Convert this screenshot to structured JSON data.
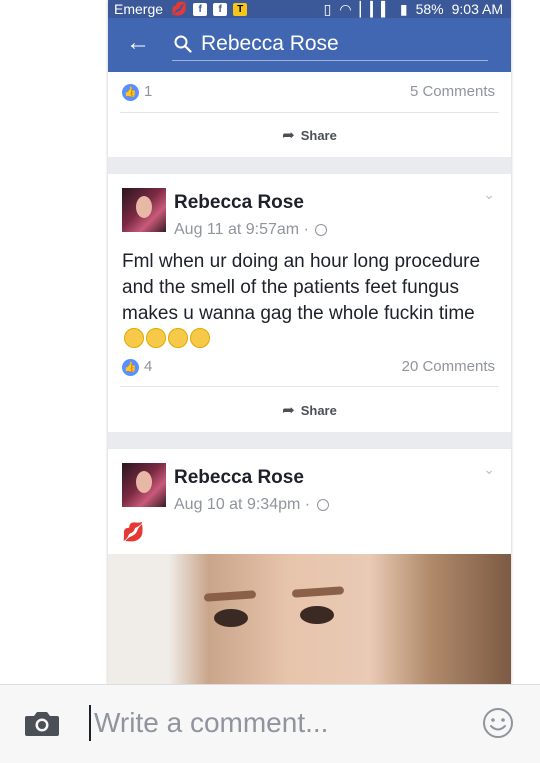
{
  "status_bar": {
    "carrier": "Emerge",
    "battery": "58%",
    "time": "9:03 AM"
  },
  "search": {
    "query": "Rebecca Rose"
  },
  "posts": [
    {
      "likes": "1",
      "comments": "5 Comments",
      "share_label": "Share"
    },
    {
      "author": "Rebecca Rose",
      "timestamp": "Aug 11 at 9:57am",
      "separator": "·",
      "text": "Fml when ur doing an hour long procedure and the smell of the patients feet fungus makes u wanna gag the whole fuckin time",
      "likes": "4",
      "comments": "20 Comments",
      "share_label": "Share"
    },
    {
      "author": "Rebecca Rose",
      "timestamp": "Aug 10 at 9:34pm",
      "separator": "·"
    }
  ],
  "composer": {
    "placeholder": "Write a comment..."
  },
  "colors": {
    "brand": "#3b5998",
    "navbar": "#4267b2",
    "like": "#5890ff"
  },
  "icons": [
    "back-arrow-icon",
    "search-icon",
    "share-arrow-icon",
    "globe-icon",
    "chevron-down-icon",
    "camera-icon",
    "smiley-icon",
    "kiss-lips-icon",
    "like-thumb-icon"
  ]
}
